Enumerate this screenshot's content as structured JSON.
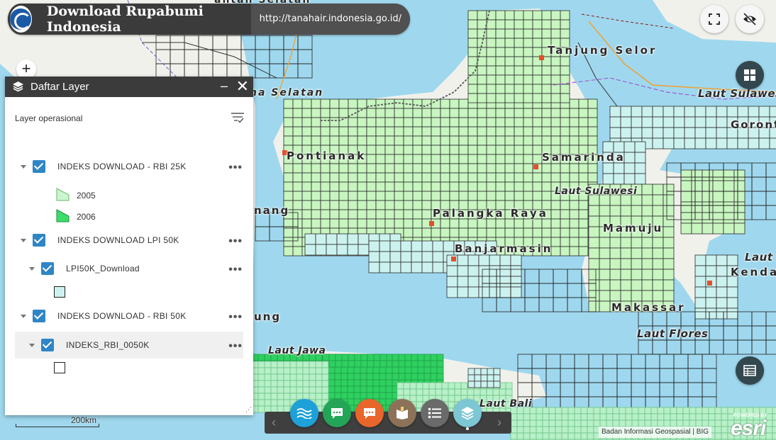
{
  "app": {
    "title": "Download Rupabumi Indonesia",
    "url": "http://tanahair.indonesia.go.id/"
  },
  "map": {
    "labels": {
      "tanjung_selor": "Tanjung Selor",
      "laut_sulawesi_ne": "Laut Sulawesi",
      "pontianak": "Pontianak",
      "samarinda": "Samarinda",
      "laut_sulawesi_mid": "Laut Sulawesi",
      "palangkaraya": "Palangka Raya",
      "banjarmasin": "Banjarmasin",
      "mamuju": "Mamuju",
      "kendari": "Kendari",
      "makassar": "Makassar",
      "laut_flores": "Laut Flores",
      "laut_jawa": "Laut Jawa",
      "laut_bali": "Laut Bali",
      "nang": "nang",
      "ung": "ung",
      "ulatan": "ha Selatan",
      "top_kalbar": "antan Selatan",
      "laut_b": "Laut B",
      "gorontalo_partial": "Gorontalo"
    },
    "scale": "200km",
    "colors": {
      "sea": "#9fd8ee",
      "land": "#f2f2ee",
      "grid_light": "#c8f5c0",
      "grid_tile": "#ccf2ef",
      "grid_green": "#2fd060"
    }
  },
  "controls": {
    "zoom_in": "+",
    "fullscreen_icon": "fullscreen-icon",
    "visibility_icon": "eye-off-icon"
  },
  "panel": {
    "title": "Daftar Layer",
    "minimize": "–",
    "close": "✕",
    "operational_label": "Layer operasional",
    "more": "•••",
    "layers": [
      {
        "label": "INDEKS DOWNLOAD - RBI 25K",
        "checked": true
      },
      {
        "label": "INDEKS DOWNLOAD LPI 50K",
        "checked": true
      },
      {
        "label": "LPI50K_Download",
        "checked": true
      },
      {
        "label": "INDEKS DOWNLOAD - RBI 50K",
        "checked": true
      },
      {
        "label": "INDEKS_RBI_0050K",
        "checked": true
      }
    ],
    "legend": {
      "y2005": "2005",
      "y2006": "2006",
      "color_2005": "#ccf5cf",
      "color_2006": "#3ddd6a",
      "color_lpi": "#ccf2ef",
      "color_rbi50": "#ffffff"
    }
  },
  "dock": {
    "prev": "‹",
    "next": "›",
    "buttons": [
      {
        "name": "basemap-waves-icon",
        "color": "#1ea1d8"
      },
      {
        "name": "chat-green-icon",
        "color": "#24a457"
      },
      {
        "name": "chat-orange-icon",
        "color": "#e8662b"
      },
      {
        "name": "map-book-icon",
        "color": "#8c7259"
      },
      {
        "name": "list-icon",
        "color": "#6a6a6a"
      },
      {
        "name": "layers-icon",
        "color": "#7dc6d3"
      }
    ]
  },
  "attribution": {
    "text": "Badan Informasi Geospasial | BIG",
    "powered": "POWERED BY",
    "esri": "esri"
  }
}
